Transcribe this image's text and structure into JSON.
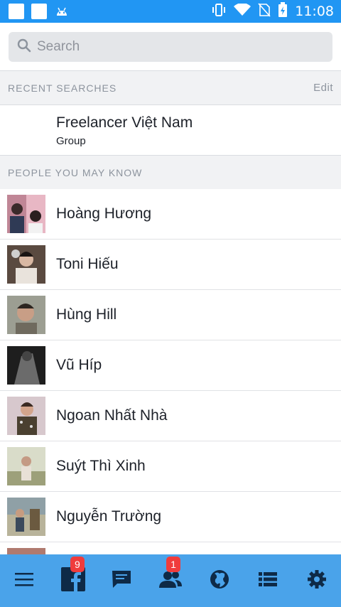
{
  "status_bar": {
    "time": "11:08",
    "icons": [
      "notification-square-icon",
      "notification-square-icon",
      "android-icon",
      "vibrate-icon",
      "wifi-icon",
      "no-sim-icon",
      "battery-charging-icon"
    ]
  },
  "search": {
    "placeholder": "Search",
    "value": ""
  },
  "recent": {
    "header": "RECENT SEARCHES",
    "edit_label": "Edit",
    "items": [
      {
        "name": "Freelancer Việt Nam",
        "subtitle": "Group"
      }
    ]
  },
  "people_section": {
    "header": "PEOPLE YOU MAY KNOW",
    "items": [
      {
        "name": "Hoàng Hương",
        "avatar_color": "#b9707f"
      },
      {
        "name": "Toni Hiếu",
        "avatar_color": "#4b3b35"
      },
      {
        "name": "Hùng Hill",
        "avatar_color": "#8d8f83"
      },
      {
        "name": "Vũ Híp",
        "avatar_color": "#3a3a3a"
      },
      {
        "name": "Ngoan Nhất Nhà",
        "avatar_color": "#b09aa0"
      },
      {
        "name": "Suýt Thì Xinh",
        "avatar_color": "#c7cbb5"
      },
      {
        "name": "Nguyễn Trường",
        "avatar_color": "#8f8a6b"
      },
      {
        "name": "",
        "avatar_color": "#b07a6f"
      }
    ]
  },
  "bottom_nav": {
    "items": [
      {
        "icon": "menu-icon",
        "badge": ""
      },
      {
        "icon": "facebook-icon",
        "badge": "9"
      },
      {
        "icon": "chat-icon",
        "badge": ""
      },
      {
        "icon": "friends-icon",
        "badge": "1"
      },
      {
        "icon": "globe-icon",
        "badge": ""
      },
      {
        "icon": "feed-list-icon",
        "badge": ""
      },
      {
        "icon": "settings-gear-icon",
        "badge": ""
      }
    ]
  },
  "colors": {
    "status_bar": "#2196f3",
    "bottom_nav": "#4aa3ea",
    "nav_icon": "#0e2a47",
    "badge": "#f03c3c"
  }
}
